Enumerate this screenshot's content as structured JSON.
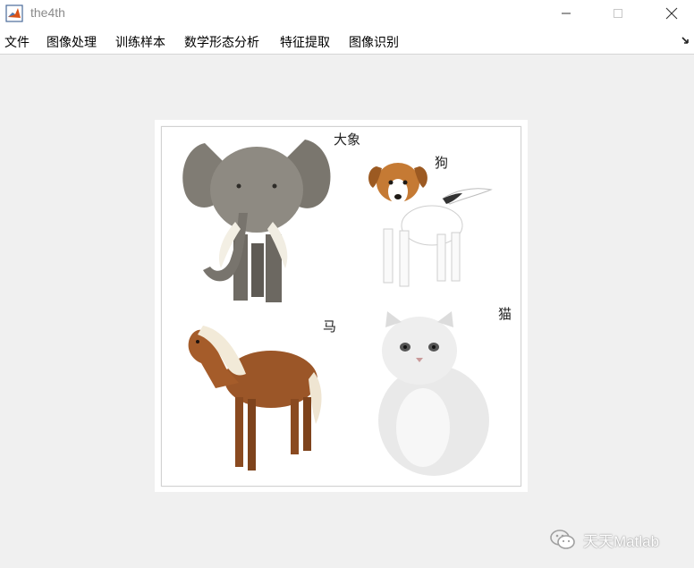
{
  "window": {
    "title": "the4th"
  },
  "menu": {
    "items": [
      "文件",
      "图像处理",
      "训练样本",
      "数学形态分析",
      "特征提取",
      "图像识别"
    ]
  },
  "figure": {
    "labels": {
      "elephant": "大象",
      "dog": "狗",
      "horse": "马",
      "cat": "猫"
    }
  },
  "watermark": {
    "text": "天天Matlab"
  }
}
